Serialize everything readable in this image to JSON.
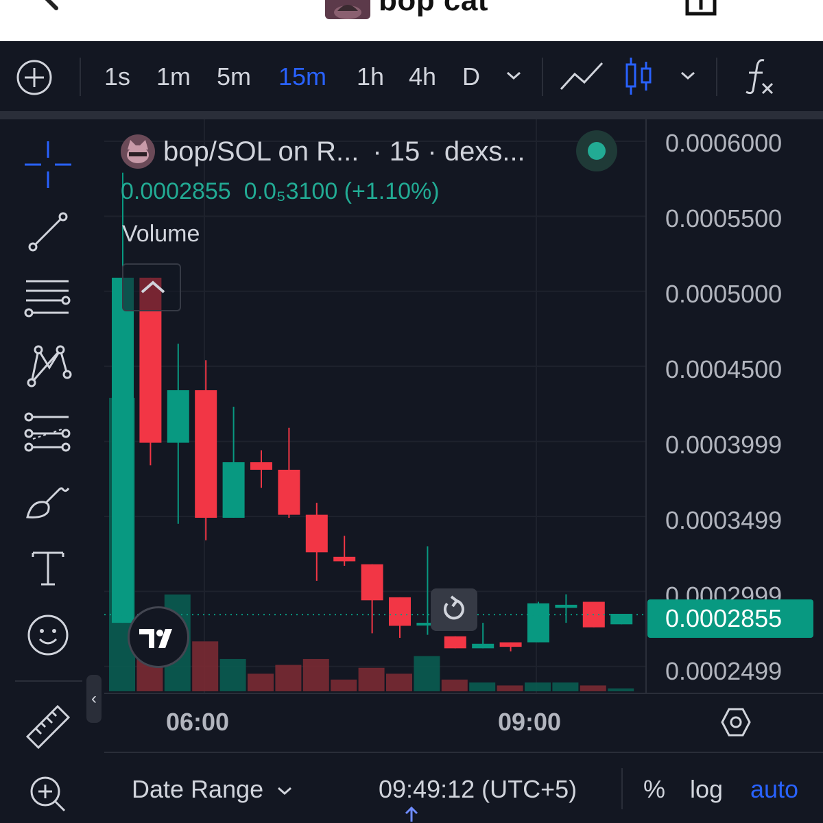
{
  "app": {
    "title": "bop cat"
  },
  "toolbar": {
    "intervals": [
      "1s",
      "1m",
      "5m",
      "15m",
      "1h",
      "4h",
      "D"
    ],
    "active_interval": "15m"
  },
  "legend": {
    "symbol": "bop/SOL on R...",
    "details": "· 15 · dexs...",
    "price": "0.0002855",
    "change": "0.0₅3100 (+1.10%)",
    "volume_label": "Volume"
  },
  "price_scale": {
    "labels": [
      "0.0006000",
      "0.0005500",
      "0.0005000",
      "0.0004500",
      "0.0003999",
      "0.0003499",
      "0.0002999",
      "0.0002499"
    ],
    "last_price": "0.0002855"
  },
  "time_axis": {
    "labels": [
      "06:00",
      "09:00"
    ]
  },
  "bottom_bar": {
    "date_range": "Date Range",
    "clock": "09:49:12 (UTC+5)",
    "percent": "%",
    "log": "log",
    "auto": "auto"
  },
  "colors": {
    "background": "#131722",
    "up": "#089981",
    "down": "#f23645",
    "accent": "#2962ff",
    "text": "#d1d4dc"
  },
  "icons": {
    "left_toolbar": [
      "crosshair-icon",
      "trend-line-icon",
      "horizontal-lines-icon",
      "pattern-icon",
      "fib-icon",
      "brush-icon",
      "text-icon",
      "emoji-icon",
      "ruler-icon",
      "zoom-icon"
    ]
  },
  "chart_data": {
    "type": "candlestick",
    "y_range": [
      0.000238,
      0.000621
    ],
    "x_labels": [
      "06:00",
      "09:00"
    ],
    "candles": [
      {
        "o": 0.00028,
        "h": 0.00058,
        "l": 0.00028,
        "c": 0.00051
      },
      {
        "o": 0.00051,
        "h": 0.00051,
        "l": 0.000385,
        "c": 0.0004
      },
      {
        "o": 0.0004,
        "h": 0.000466,
        "l": 0.000346,
        "c": 0.000435
      },
      {
        "o": 0.000435,
        "h": 0.000455,
        "l": 0.000335,
        "c": 0.00035
      },
      {
        "o": 0.00035,
        "h": 0.000424,
        "l": 0.00035,
        "c": 0.000387
      },
      {
        "o": 0.000387,
        "h": 0.000395,
        "l": 0.00037,
        "c": 0.000382
      },
      {
        "o": 0.000382,
        "h": 0.00041,
        "l": 0.00035,
        "c": 0.000352
      },
      {
        "o": 0.000352,
        "h": 0.00036,
        "l": 0.000308,
        "c": 0.000327
      },
      {
        "o": 0.000324,
        "h": 0.000338,
        "l": 0.000318,
        "c": 0.000321
      },
      {
        "o": 0.000319,
        "h": 0.000319,
        "l": 0.000273,
        "c": 0.000295
      },
      {
        "o": 0.000297,
        "h": 0.000297,
        "l": 0.00027,
        "c": 0.000278
      },
      {
        "o": 0.00028,
        "h": 0.000331,
        "l": 0.000272,
        "c": 0.00028
      },
      {
        "o": 0.000271,
        "h": 0.000271,
        "l": 0.000263,
        "c": 0.000263
      },
      {
        "o": 0.000263,
        "h": 0.00028,
        "l": 0.000263,
        "c": 0.000266
      },
      {
        "o": 0.000267,
        "h": 0.000267,
        "l": 0.000261,
        "c": 0.000264
      },
      {
        "o": 0.000267,
        "h": 0.000294,
        "l": 0.000267,
        "c": 0.000293
      },
      {
        "o": 0.00029,
        "h": 0.000299,
        "l": 0.00028,
        "c": 0.000292
      },
      {
        "o": 0.000294,
        "h": 0.000294,
        "l": 0.000277,
        "c": 0.000277
      },
      {
        "o": 0.000279,
        "h": 0.000285,
        "l": 0.000279,
        "c": 0.000286
      }
    ],
    "volume": [
      {
        "v": 1.0,
        "up": true
      },
      {
        "v": 0.14,
        "up": false
      },
      {
        "v": 0.33,
        "up": true
      },
      {
        "v": 0.17,
        "up": false
      },
      {
        "v": 0.11,
        "up": true
      },
      {
        "v": 0.06,
        "up": false
      },
      {
        "v": 0.09,
        "up": false
      },
      {
        "v": 0.11,
        "up": false
      },
      {
        "v": 0.04,
        "up": false
      },
      {
        "v": 0.08,
        "up": false
      },
      {
        "v": 0.06,
        "up": false
      },
      {
        "v": 0.12,
        "up": true
      },
      {
        "v": 0.04,
        "up": false
      },
      {
        "v": 0.03,
        "up": true
      },
      {
        "v": 0.02,
        "up": false
      },
      {
        "v": 0.03,
        "up": true
      },
      {
        "v": 0.03,
        "up": true
      },
      {
        "v": 0.02,
        "up": false
      },
      {
        "v": 0.01,
        "up": true
      }
    ],
    "last_price": 0.0002855
  }
}
